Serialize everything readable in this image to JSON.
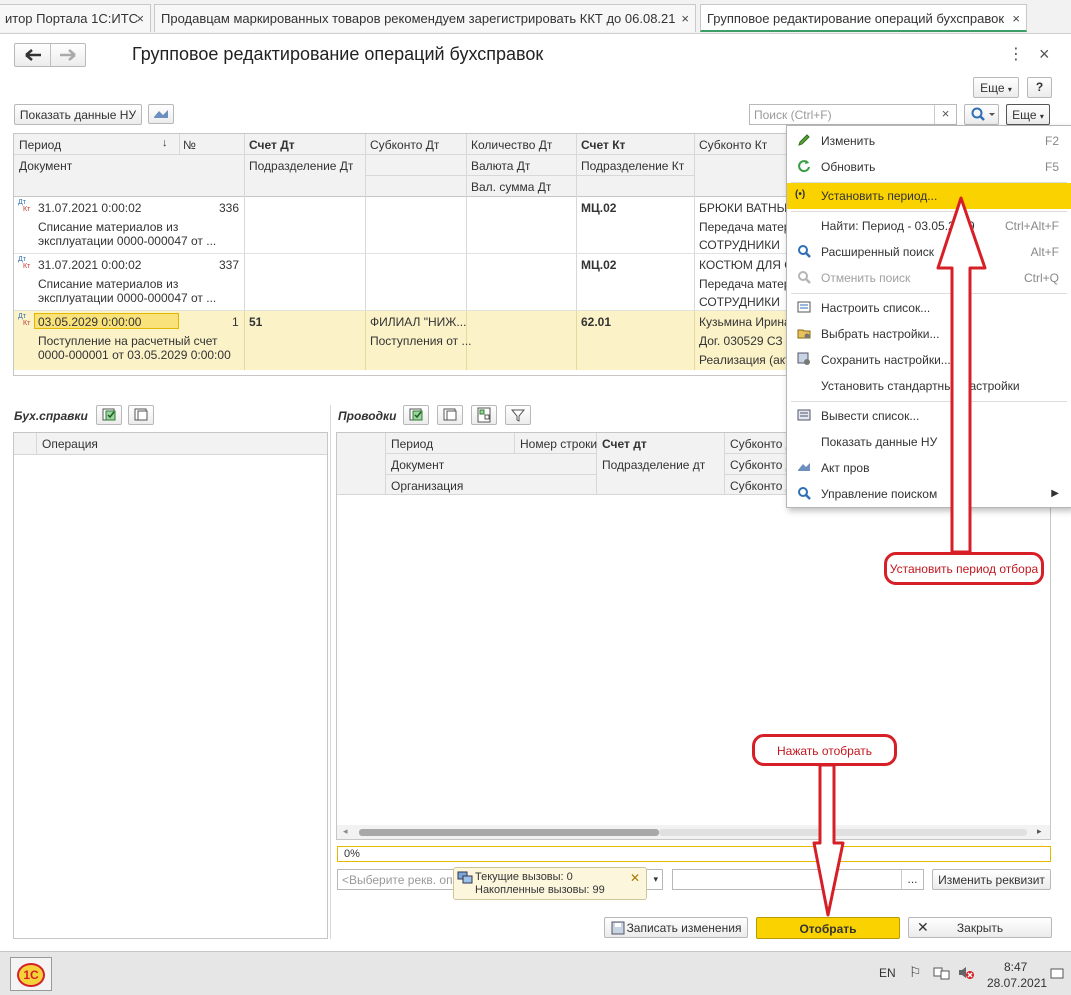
{
  "tabs": [
    {
      "label": "итор Портала 1С:ИТС",
      "close": "×"
    },
    {
      "label": "Продавцам маркированных товаров рекомендуем зарегистрировать ККТ до 06.08.21",
      "close": "×"
    },
    {
      "label": "Групповое редактирование операций бухсправок",
      "close": "×"
    }
  ],
  "window": {
    "title": "Групповое редактирование операций бухсправок",
    "menu_dots": "⋮",
    "close": "×"
  },
  "toolbar": {
    "more": "Еще",
    "help": "?",
    "show_nu": "Показать данные НУ",
    "search_placeholder": "Поиск (Ctrl+F)",
    "search_clear": "×",
    "more2": "Еще"
  },
  "colors": {
    "accent_yellow": "#f9d200",
    "selection": "#fbf2c8",
    "annotation_red": "#d61f26"
  },
  "main_table": {
    "headers": {
      "period": "Период",
      "num": "№",
      "schet_dt": "Счет Дт",
      "subkonto_dt": "Субконто Дт",
      "kol_dt": "Количество Дт",
      "schet_kt": "Счет Кт",
      "subkonto_kt": "Субконто Кт",
      "document": "Документ",
      "podr_dt": "Подразделение Дт",
      "valuta_dt": "Валюта Дт",
      "val_summa_dt": "Вал. сумма Дт",
      "podr_kt": "Подразделение Кт"
    },
    "rows": [
      {
        "date": "31.07.2021 0:00:02",
        "num": "336",
        "doc1": "Списание материалов из",
        "doc2": "эксплуатации 0000-000047 от ...",
        "schet_dt": "",
        "sub_dt": "",
        "schet_kt": "МЦ.02",
        "sk1": "БРЮКИ ВАТНЫЕ",
        "sk2": "Передача матер...",
        "sk3": "СОТРУДНИКИ"
      },
      {
        "date": "31.07.2021 0:00:02",
        "num": "337",
        "doc1": "Списание материалов из",
        "doc2": "эксплуатации 0000-000047 от ...",
        "schet_dt": "",
        "sub_dt": "",
        "schet_kt": "МЦ.02",
        "sk1": "КОСТЮМ ДЛЯ С",
        "sk2": "Передача матер...",
        "sk3": "СОТРУДНИКИ"
      },
      {
        "date": "03.05.2029 0:00:00",
        "num": "1",
        "doc1": "Поступление на расчетный счет",
        "doc2": "0000-000001 от 03.05.2029 0:00:00",
        "schet_dt": "51",
        "sub_dt": "ФИЛИАЛ \"НИЖ...",
        "sub_dt2": "Поступления от ...",
        "schet_kt": "62.01",
        "sk1": "Кузьмина Ирина",
        "sk2": "Дог. 030529 СЗ",
        "sk3": "Реализация (акт..."
      }
    ]
  },
  "dt_icon": {
    "top": "Дт",
    "bottom": "Кт"
  },
  "left_panel": {
    "title": "Бух.справки",
    "col": "Операция"
  },
  "right_panel": {
    "title": "Проводки",
    "headers": {
      "period": "Период",
      "nomer": "Номер строки",
      "schet_dt": "Счет дт",
      "subkonto": "Субконто д",
      "document": "Документ",
      "podr_dt": "Подразделение дт",
      "subkonto2": "Субконто д",
      "org": "Организация",
      "subkonto3": "Субконто д"
    }
  },
  "progress": "0%",
  "rekv": {
    "placeholder": "<Выберите рекв. опер",
    "dots": "...",
    "change": "Изменить реквизит"
  },
  "tooltip": {
    "line1": "Текущие вызовы: 0",
    "line2": "Накопленные вызовы: 99"
  },
  "bottom_buttons": {
    "save": "Записать изменения",
    "select": "Отобрать",
    "close": "Закрыть"
  },
  "menu": {
    "items": [
      {
        "label": "Изменить",
        "shortcut": "F2",
        "icon": "pencil-icon"
      },
      {
        "label": "Обновить",
        "shortcut": "F5",
        "icon": "refresh-icon"
      },
      {
        "label": "Установить период...",
        "shortcut": "",
        "icon": "period-icon"
      },
      {
        "label": "Найти: Период - 03.05.2029",
        "shortcut": "Ctrl+Alt+F",
        "icon": ""
      },
      {
        "label": "Расширенный поиск",
        "shortcut": "Alt+F",
        "icon": "search-icon"
      },
      {
        "label": "Отменить поиск",
        "shortcut": "Ctrl+Q",
        "icon": "search-cancel-icon"
      },
      {
        "label": "Настроить список...",
        "shortcut": "",
        "icon": "list-settings-icon"
      },
      {
        "label": "Выбрать настройки...",
        "shortcut": "",
        "icon": "folder-gear-icon"
      },
      {
        "label": "Сохранить настройки...",
        "shortcut": "",
        "icon": "save-gear-icon"
      },
      {
        "label": "Установить стандартные настройки",
        "shortcut": "",
        "icon": ""
      },
      {
        "label": "Вывести список...",
        "shortcut": "",
        "icon": "list-output-icon"
      },
      {
        "label": "Показать данные НУ",
        "shortcut": "",
        "icon": ""
      },
      {
        "label": "Акт пров",
        "shortcut": "",
        "icon": "act-icon"
      },
      {
        "label": "Управление поиском",
        "shortcut": "",
        "icon": "search-icon"
      }
    ]
  },
  "annotations": {
    "set_period": "Установить период отбора",
    "press_select": "Нажать отобрать"
  },
  "taskbar": {
    "lang": "EN",
    "time": "8:47",
    "date": "28.07.2021",
    "app": "1С"
  }
}
